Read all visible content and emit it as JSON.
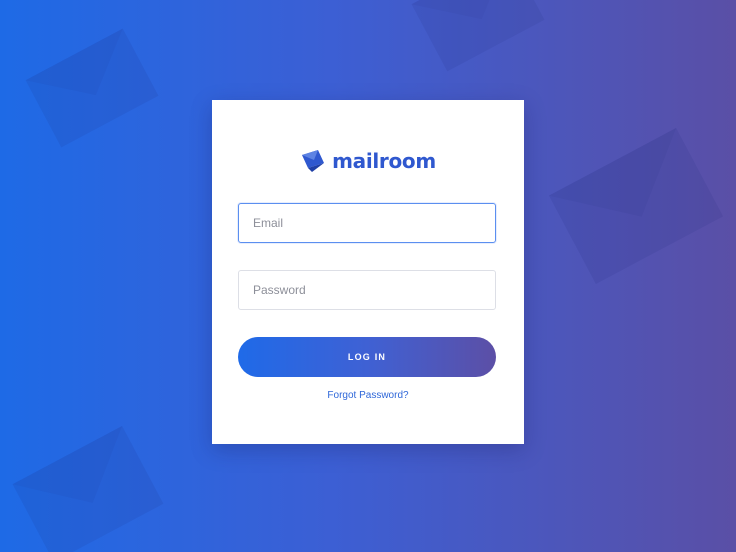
{
  "brand": {
    "name": "mailroom",
    "logo_icon": "envelope-logo-icon",
    "color": "#2f58cf"
  },
  "login_form": {
    "email_placeholder": "Email",
    "password_placeholder": "Password",
    "submit_label": "LOG IN",
    "forgot_link": "Forgot Password?"
  },
  "colors": {
    "background_start": "#1e6ae6",
    "background_end": "#5a4fa6",
    "card": "#ffffff",
    "input_focus_border": "#5b8ff0",
    "input_border": "#dddfe6",
    "link": "#2e67d9"
  },
  "decorations": {
    "background_icon": "envelope-icon"
  }
}
